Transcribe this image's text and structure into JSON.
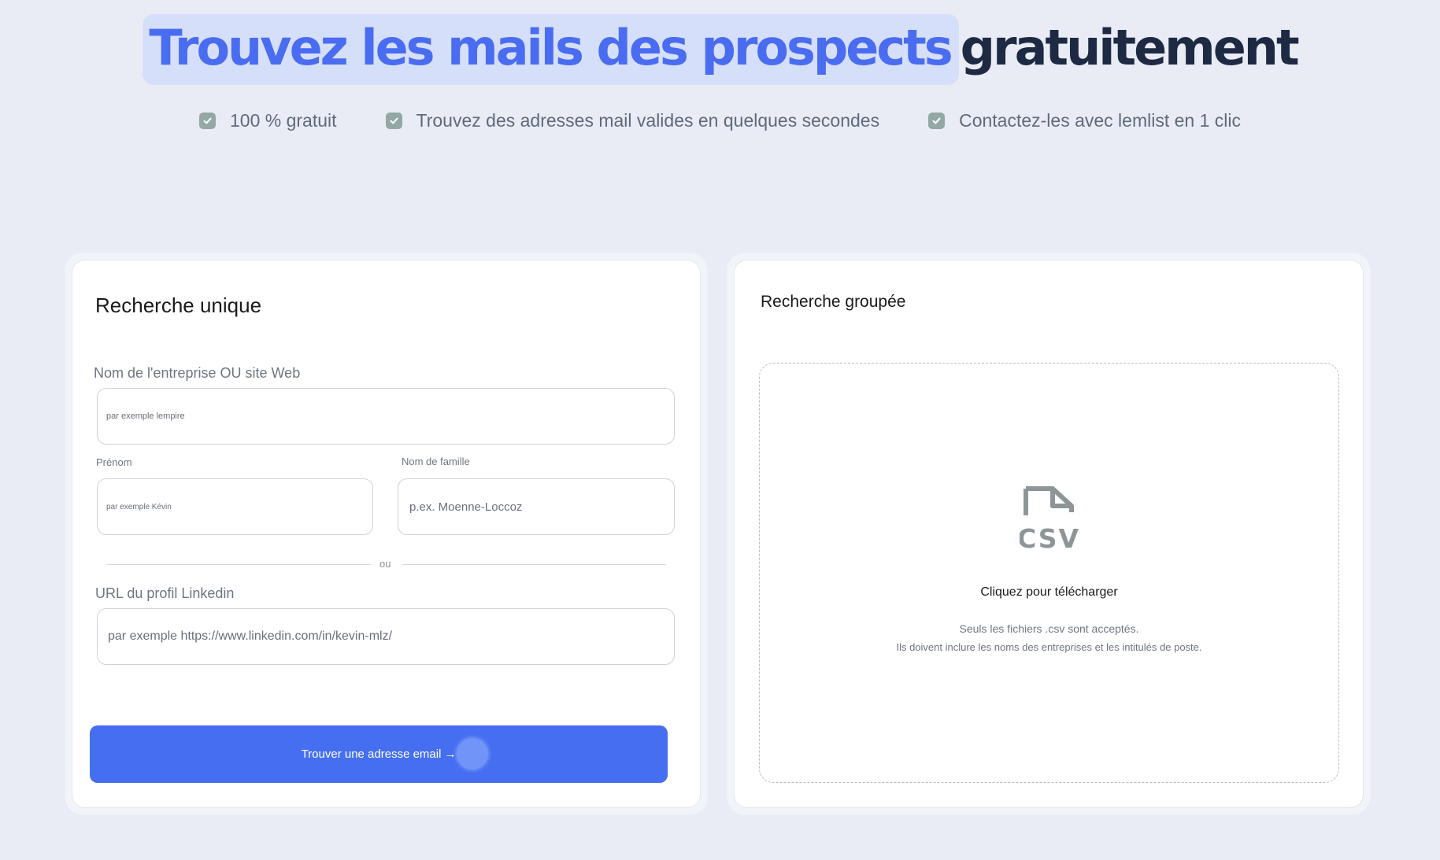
{
  "hero": {
    "title_highlight": "Trouvez les mails des prospects",
    "title_rest": "gratuitement"
  },
  "features": [
    "100 % gratuit",
    "Trouvez des adresses mail valides en quelques secondes",
    "Contactez-les avec lemlist en 1 clic"
  ],
  "single_search": {
    "title": "Recherche unique",
    "company_label": "Nom de l'entreprise OU site Web",
    "company_placeholder": "par exemple lempire",
    "firstname_label": "Prénom",
    "firstname_placeholder": "par exemple Kévin",
    "lastname_label": "Nom de famille",
    "lastname_placeholder": "p.ex. Moenne-Loccoz",
    "divider": "ou",
    "linkedin_label": "URL du profil Linkedin",
    "linkedin_placeholder": "par exemple https://www.linkedin.com/in/kevin-mlz/",
    "submit_label": "Trouver une adresse email",
    "submit_arrow": "→"
  },
  "bulk_search": {
    "title": "Recherche groupée",
    "file_icon_text": "CSV",
    "upload_label": "Cliquez pour télécharger",
    "hint_line1": "Seuls les fichiers .csv sont acceptés.",
    "hint_line2": "Ils doivent inclure les noms des entreprises et les intitulés de poste."
  },
  "colors": {
    "accent": "#466ef1",
    "highlight_bg": "#d6dffa",
    "title_dark": "#1e2a44",
    "check": "#93a8a4",
    "background": "#e9ecf4"
  }
}
